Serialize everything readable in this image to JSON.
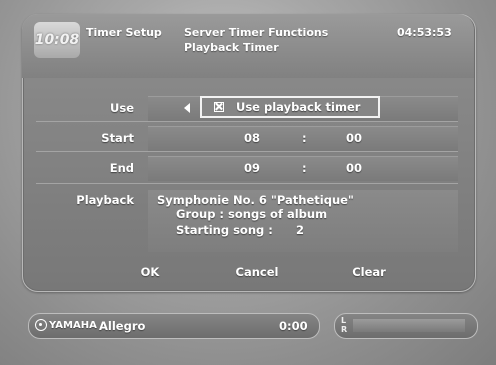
{
  "header": {
    "clock_logo": "10:08",
    "screen_name": "Timer Setup",
    "title_line1": "Server Timer Functions",
    "title_line2": "Playback Timer",
    "time": "04:53:53"
  },
  "form": {
    "use": {
      "label": "Use",
      "value": "Use playback timer",
      "checked": true
    },
    "start": {
      "label": "Start",
      "hour": "08",
      "sep": ":",
      "minute": "00"
    },
    "end": {
      "label": "End",
      "hour": "09",
      "sep": ":",
      "minute": "00"
    },
    "playback": {
      "label": "Playback",
      "title": "Symphonie No. 6 \"Pathetique\"",
      "group": "Group : songs of album",
      "starting_song_label": "Starting song :",
      "starting_song_value": "2"
    }
  },
  "buttons": {
    "ok": "OK",
    "cancel": "Cancel",
    "clear": "Clear"
  },
  "status_bar": {
    "brand": "YAMAHA",
    "track": "Allegro",
    "elapsed": "0:00",
    "level_l": "L",
    "level_r": "R"
  },
  "icons": {
    "brand_mark": "yamaha-logo-icon",
    "arrow": "left-arrow-icon",
    "checkbox": "checked-box-icon"
  }
}
